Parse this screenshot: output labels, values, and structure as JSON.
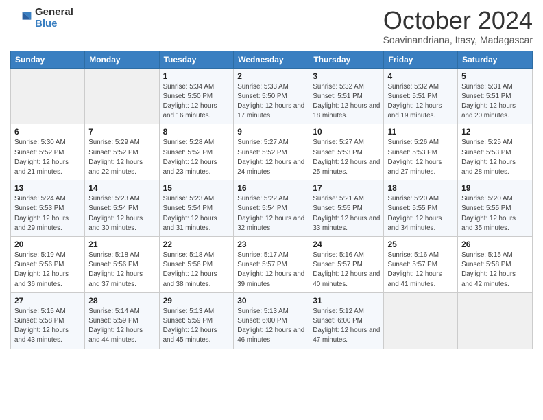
{
  "header": {
    "logo_general": "General",
    "logo_blue": "Blue",
    "month_title": "October 2024",
    "subtitle": "Soavinandriana, Itasy, Madagascar"
  },
  "weekdays": [
    "Sunday",
    "Monday",
    "Tuesday",
    "Wednesday",
    "Thursday",
    "Friday",
    "Saturday"
  ],
  "weeks": [
    [
      {
        "day": "",
        "sunrise": "",
        "sunset": "",
        "daylight": ""
      },
      {
        "day": "",
        "sunrise": "",
        "sunset": "",
        "daylight": ""
      },
      {
        "day": "1",
        "sunrise": "Sunrise: 5:34 AM",
        "sunset": "Sunset: 5:50 PM",
        "daylight": "Daylight: 12 hours and 16 minutes."
      },
      {
        "day": "2",
        "sunrise": "Sunrise: 5:33 AM",
        "sunset": "Sunset: 5:50 PM",
        "daylight": "Daylight: 12 hours and 17 minutes."
      },
      {
        "day": "3",
        "sunrise": "Sunrise: 5:32 AM",
        "sunset": "Sunset: 5:51 PM",
        "daylight": "Daylight: 12 hours and 18 minutes."
      },
      {
        "day": "4",
        "sunrise": "Sunrise: 5:32 AM",
        "sunset": "Sunset: 5:51 PM",
        "daylight": "Daylight: 12 hours and 19 minutes."
      },
      {
        "day": "5",
        "sunrise": "Sunrise: 5:31 AM",
        "sunset": "Sunset: 5:51 PM",
        "daylight": "Daylight: 12 hours and 20 minutes."
      }
    ],
    [
      {
        "day": "6",
        "sunrise": "Sunrise: 5:30 AM",
        "sunset": "Sunset: 5:52 PM",
        "daylight": "Daylight: 12 hours and 21 minutes."
      },
      {
        "day": "7",
        "sunrise": "Sunrise: 5:29 AM",
        "sunset": "Sunset: 5:52 PM",
        "daylight": "Daylight: 12 hours and 22 minutes."
      },
      {
        "day": "8",
        "sunrise": "Sunrise: 5:28 AM",
        "sunset": "Sunset: 5:52 PM",
        "daylight": "Daylight: 12 hours and 23 minutes."
      },
      {
        "day": "9",
        "sunrise": "Sunrise: 5:27 AM",
        "sunset": "Sunset: 5:52 PM",
        "daylight": "Daylight: 12 hours and 24 minutes."
      },
      {
        "day": "10",
        "sunrise": "Sunrise: 5:27 AM",
        "sunset": "Sunset: 5:53 PM",
        "daylight": "Daylight: 12 hours and 25 minutes."
      },
      {
        "day": "11",
        "sunrise": "Sunrise: 5:26 AM",
        "sunset": "Sunset: 5:53 PM",
        "daylight": "Daylight: 12 hours and 27 minutes."
      },
      {
        "day": "12",
        "sunrise": "Sunrise: 5:25 AM",
        "sunset": "Sunset: 5:53 PM",
        "daylight": "Daylight: 12 hours and 28 minutes."
      }
    ],
    [
      {
        "day": "13",
        "sunrise": "Sunrise: 5:24 AM",
        "sunset": "Sunset: 5:53 PM",
        "daylight": "Daylight: 12 hours and 29 minutes."
      },
      {
        "day": "14",
        "sunrise": "Sunrise: 5:23 AM",
        "sunset": "Sunset: 5:54 PM",
        "daylight": "Daylight: 12 hours and 30 minutes."
      },
      {
        "day": "15",
        "sunrise": "Sunrise: 5:23 AM",
        "sunset": "Sunset: 5:54 PM",
        "daylight": "Daylight: 12 hours and 31 minutes."
      },
      {
        "day": "16",
        "sunrise": "Sunrise: 5:22 AM",
        "sunset": "Sunset: 5:54 PM",
        "daylight": "Daylight: 12 hours and 32 minutes."
      },
      {
        "day": "17",
        "sunrise": "Sunrise: 5:21 AM",
        "sunset": "Sunset: 5:55 PM",
        "daylight": "Daylight: 12 hours and 33 minutes."
      },
      {
        "day": "18",
        "sunrise": "Sunrise: 5:20 AM",
        "sunset": "Sunset: 5:55 PM",
        "daylight": "Daylight: 12 hours and 34 minutes."
      },
      {
        "day": "19",
        "sunrise": "Sunrise: 5:20 AM",
        "sunset": "Sunset: 5:55 PM",
        "daylight": "Daylight: 12 hours and 35 minutes."
      }
    ],
    [
      {
        "day": "20",
        "sunrise": "Sunrise: 5:19 AM",
        "sunset": "Sunset: 5:56 PM",
        "daylight": "Daylight: 12 hours and 36 minutes."
      },
      {
        "day": "21",
        "sunrise": "Sunrise: 5:18 AM",
        "sunset": "Sunset: 5:56 PM",
        "daylight": "Daylight: 12 hours and 37 minutes."
      },
      {
        "day": "22",
        "sunrise": "Sunrise: 5:18 AM",
        "sunset": "Sunset: 5:56 PM",
        "daylight": "Daylight: 12 hours and 38 minutes."
      },
      {
        "day": "23",
        "sunrise": "Sunrise: 5:17 AM",
        "sunset": "Sunset: 5:57 PM",
        "daylight": "Daylight: 12 hours and 39 minutes."
      },
      {
        "day": "24",
        "sunrise": "Sunrise: 5:16 AM",
        "sunset": "Sunset: 5:57 PM",
        "daylight": "Daylight: 12 hours and 40 minutes."
      },
      {
        "day": "25",
        "sunrise": "Sunrise: 5:16 AM",
        "sunset": "Sunset: 5:57 PM",
        "daylight": "Daylight: 12 hours and 41 minutes."
      },
      {
        "day": "26",
        "sunrise": "Sunrise: 5:15 AM",
        "sunset": "Sunset: 5:58 PM",
        "daylight": "Daylight: 12 hours and 42 minutes."
      }
    ],
    [
      {
        "day": "27",
        "sunrise": "Sunrise: 5:15 AM",
        "sunset": "Sunset: 5:58 PM",
        "daylight": "Daylight: 12 hours and 43 minutes."
      },
      {
        "day": "28",
        "sunrise": "Sunrise: 5:14 AM",
        "sunset": "Sunset: 5:59 PM",
        "daylight": "Daylight: 12 hours and 44 minutes."
      },
      {
        "day": "29",
        "sunrise": "Sunrise: 5:13 AM",
        "sunset": "Sunset: 5:59 PM",
        "daylight": "Daylight: 12 hours and 45 minutes."
      },
      {
        "day": "30",
        "sunrise": "Sunrise: 5:13 AM",
        "sunset": "Sunset: 6:00 PM",
        "daylight": "Daylight: 12 hours and 46 minutes."
      },
      {
        "day": "31",
        "sunrise": "Sunrise: 5:12 AM",
        "sunset": "Sunset: 6:00 PM",
        "daylight": "Daylight: 12 hours and 47 minutes."
      },
      {
        "day": "",
        "sunrise": "",
        "sunset": "",
        "daylight": ""
      },
      {
        "day": "",
        "sunrise": "",
        "sunset": "",
        "daylight": ""
      }
    ]
  ]
}
